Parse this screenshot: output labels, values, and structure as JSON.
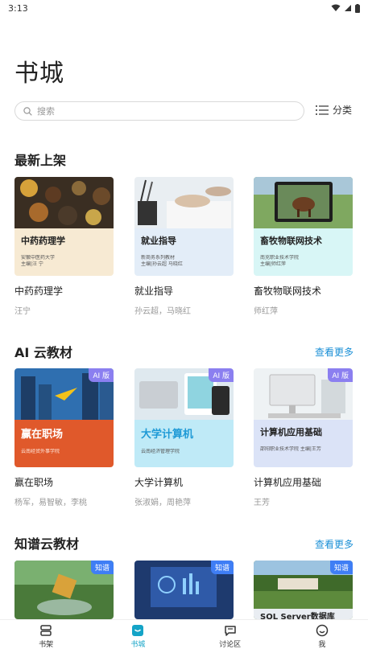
{
  "status": {
    "time": "3:13"
  },
  "page_title": "书城",
  "search": {
    "placeholder": "搜索"
  },
  "category_label": "分类",
  "sections": {
    "latest": {
      "title": "最新上架",
      "books": [
        {
          "cover_title": "中药药理学",
          "cover_sub": "安徽中医药大学\n主编|汪 宁",
          "name": "中药药理学",
          "author": "汪宁"
        },
        {
          "cover_title": "就业指导",
          "cover_sub": "新商务系列教材\n主编|孙云超  马晓红",
          "name": "就业指导",
          "author": "孙云超，马晓红"
        },
        {
          "cover_title": "畜牧物联网技术",
          "cover_sub": "南充职业技术学院\n主编|师红萍",
          "name": "畜牧物联网技术",
          "author": "师红萍"
        }
      ]
    },
    "ai": {
      "title": "AI 云教材",
      "see_more": "查看更多",
      "tag": "AI 版",
      "books": [
        {
          "cover_title": "赢在职场",
          "cover_sub": "云南经贸外事学院",
          "name": "赢在职场",
          "author": "杨军，易智敏，李桃"
        },
        {
          "cover_title": "大学计算机",
          "cover_sub": "云南经济管理学院",
          "name": "大学计算机",
          "author": "张淑娟，周艳萍"
        },
        {
          "cover_title": "计算机应用基础",
          "cover_sub": "邵阳职业技术学院  主编|王芳",
          "name": "计算机应用基础",
          "author": "王芳"
        }
      ]
    },
    "kg": {
      "title": "知谱云教材",
      "see_more": "查看更多",
      "tag": "知谱",
      "books": [
        {
          "cover_title": "",
          "name": "",
          "author": ""
        },
        {
          "cover_title": "",
          "name": "",
          "author": ""
        },
        {
          "cover_title": "SQL Server数据库",
          "name": "",
          "author": ""
        }
      ]
    }
  },
  "tabs": [
    {
      "label": "书架",
      "icon": "bookshelf-icon"
    },
    {
      "label": "书城",
      "icon": "bookstore-icon"
    },
    {
      "label": "讨论区",
      "icon": "discussion-icon"
    },
    {
      "label": "我",
      "icon": "profile-icon"
    }
  ],
  "colors": {
    "accent": "#15a4c7",
    "link": "#1a8fd6",
    "ai_tag": "#8b7ff0",
    "kg_tag": "#3f7ef5"
  }
}
